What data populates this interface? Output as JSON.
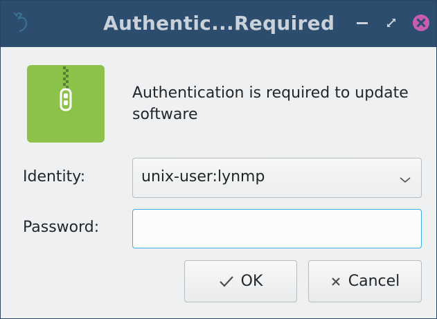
{
  "window": {
    "title": "Authentic...Required",
    "accent_color": "#2c4d6d",
    "close_color": "#da4453"
  },
  "content": {
    "icon": "zip-lock-icon",
    "icon_color": "#8bc34a",
    "message": "Authentication is required to update software"
  },
  "form": {
    "identity_label": "Identity:",
    "identity_value": "unix-user:lynmp",
    "password_label": "Password:",
    "password_value": ""
  },
  "buttons": {
    "ok_label": "OK",
    "cancel_label": "Cancel"
  }
}
